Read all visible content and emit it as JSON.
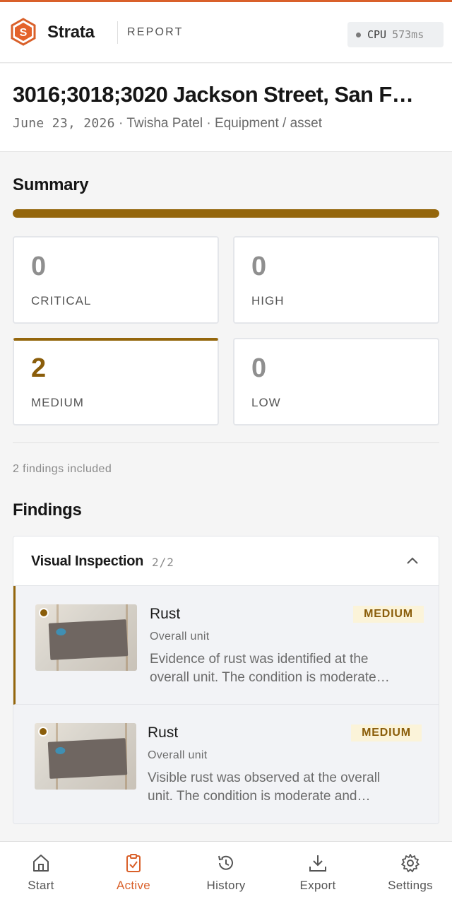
{
  "header": {
    "brand": "Strata",
    "section": "REPORT",
    "cpu_label": "CPU",
    "cpu_value": "573ms"
  },
  "report": {
    "title": "3016;3018;3020 Jackson Street, San F…",
    "date": "June 23, 2026",
    "inspector": " · Twisha Patel · ",
    "category": "Equipment / asset"
  },
  "summary": {
    "heading": "Summary",
    "progress_fraction": 1.0,
    "stats": [
      {
        "value": "0",
        "label": "CRITICAL"
      },
      {
        "value": "0",
        "label": "HIGH"
      },
      {
        "value": "2",
        "label": "MEDIUM"
      },
      {
        "value": "0",
        "label": "LOW"
      }
    ],
    "findings_included": "2 findings included"
  },
  "findings": {
    "heading": "Findings",
    "group": {
      "title": "Visual Inspection",
      "count": "2/2"
    },
    "items": [
      {
        "title": "Rust",
        "location": "Overall unit",
        "severity": "MEDIUM",
        "desc_line1": "Evidence of rust was identified at the",
        "desc_line2": "overall unit. The condition is moderate…"
      },
      {
        "title": "Rust",
        "location": "Overall unit",
        "severity": "MEDIUM",
        "desc_line1": "Visible rust was observed at the overall",
        "desc_line2": "unit. The condition is moderate and…"
      }
    ]
  },
  "nav": {
    "items": [
      {
        "label": "Start",
        "icon": "home-icon"
      },
      {
        "label": "Active",
        "icon": "clipboard-check-icon"
      },
      {
        "label": "History",
        "icon": "history-icon"
      },
      {
        "label": "Export",
        "icon": "download-icon"
      },
      {
        "label": "Settings",
        "icon": "gear-icon"
      }
    ],
    "active_index": 1
  },
  "colors": {
    "accent": "#d9602a",
    "medium": "#94660c",
    "medium_badge_bg": "#fbf3d9"
  }
}
